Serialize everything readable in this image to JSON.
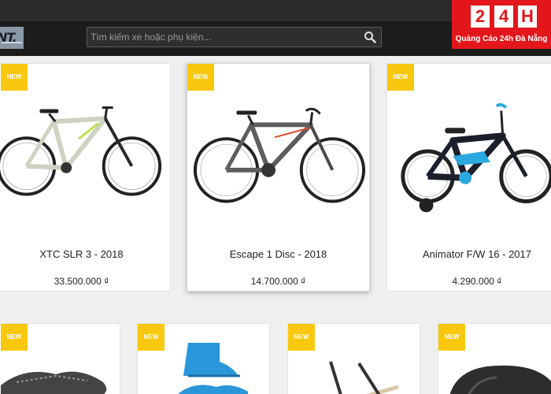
{
  "header": {
    "logo_text": "NT.",
    "search_placeholder": "Tìm kiếm xe hoặc phụ kiện..."
  },
  "watermark": {
    "chars": [
      "2",
      "4",
      "H"
    ],
    "caption": "Quảng Cáo 24h Đà Nẵng"
  },
  "products": [
    {
      "badge": "NEW",
      "name": "XTC SLR 3 - 2018",
      "price": "33.500.000 ₫"
    },
    {
      "badge": "NEW",
      "name": "Escape 1 Disc - 2018",
      "price": "14.700.000 ₫"
    },
    {
      "badge": "NEW",
      "name": "Animator F/W 16 - 2017",
      "price": "4.290.000 ₫"
    }
  ],
  "bottom_row": [
    {
      "badge": "NEW"
    },
    {
      "badge": "NEW"
    },
    {
      "badge": "NEW"
    },
    {
      "badge": "NEW"
    }
  ],
  "colors": {
    "badge_yellow": "#f9c80e",
    "header_dark": "#1c1c1c",
    "brand_red": "#e3171b"
  }
}
